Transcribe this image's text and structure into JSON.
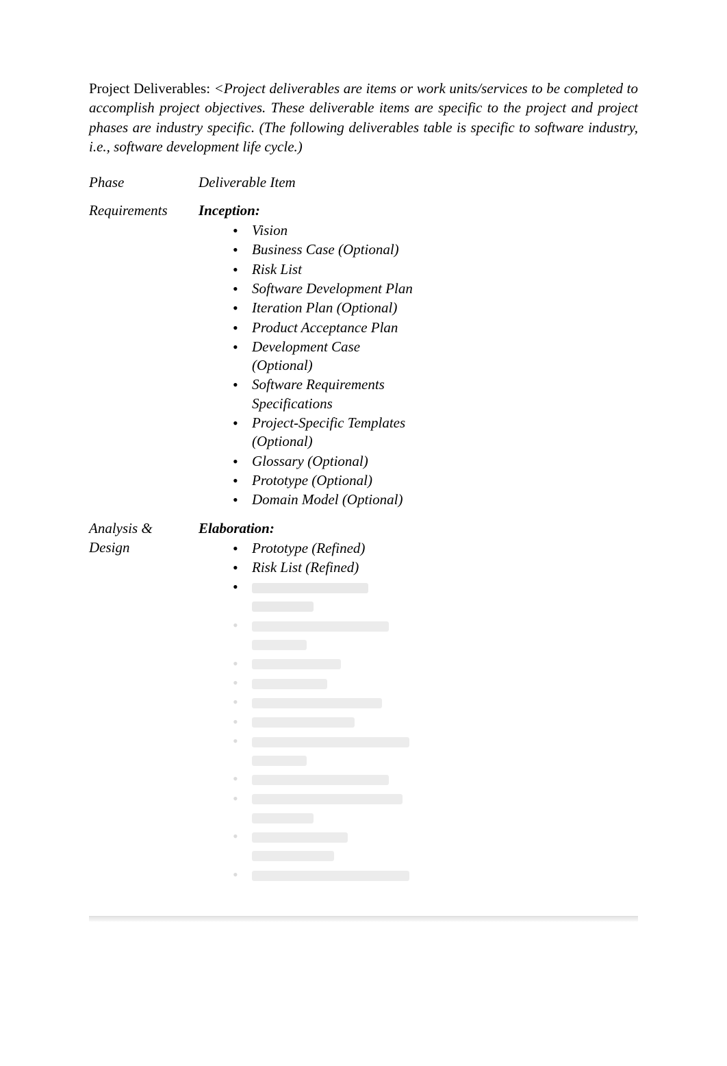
{
  "intro_label": "Project Deliverables: ",
  "intro_desc": "<Project deliverables are items or work units/services to be completed to accomplish project objectives. These deliverable items are specific to the project and project phases are industry specific. (The following deliverables table is specific to software industry, i.e., software development life cycle.)",
  "table": {
    "header_phase": "Phase",
    "header_item": "Deliverable Item",
    "rows": [
      {
        "phase": "Requirements",
        "section": "Inception:",
        "items": [
          "Vision",
          "Business Case (Optional)",
          "Risk List",
          "Software Development Plan",
          "Iteration Plan (Optional)",
          "Product Acceptance Plan",
          "Development Case (Optional)",
          "Software Requirements Specifications",
          "Project-Specific Templates (Optional)",
          "Glossary (Optional)",
          "Prototype (Optional)",
          "Domain Model (Optional)"
        ]
      },
      {
        "phase": "Analysis & Design",
        "section": "Elaboration:",
        "items": [
          "Prototype (Refined)",
          "Risk List (Refined)"
        ]
      }
    ]
  },
  "redacted_widths": [
    [
      170,
      90
    ],
    [
      200,
      80
    ],
    [
      130
    ],
    [
      110
    ],
    [
      190
    ],
    [
      150
    ],
    [
      230,
      80
    ],
    [
      200
    ],
    [
      220,
      90
    ],
    [
      140,
      120
    ],
    [
      230
    ]
  ]
}
